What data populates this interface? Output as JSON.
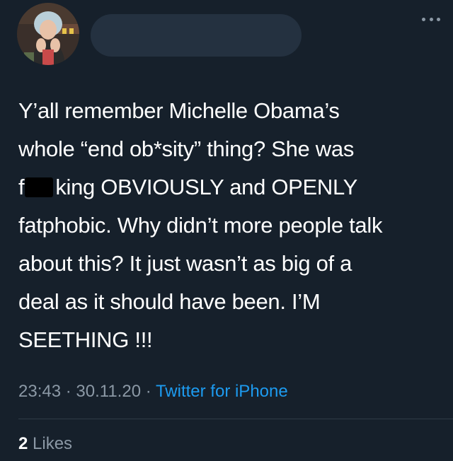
{
  "tweet": {
    "avatar_icon": "profile-photo",
    "text_lines": [
      "Y’all remember Michelle Obama’s",
      "whole “end ob*sity” thing? She was",
      [
        "f",
        "king OBVIOUSLY and OPENLY"
      ],
      "fatphobic. Why didn’t more people talk",
      "about this? It just wasn’t as big of a",
      "deal as it should have been. I’M",
      "SEETHING !!!"
    ],
    "time": "23:43",
    "date": "30.11.20",
    "separator": "·",
    "source": "Twitter for iPhone",
    "likes_count": "2",
    "likes_label": "Likes"
  },
  "colors": {
    "background": "#16202b",
    "text": "#ffffff",
    "muted": "#8b98a5",
    "link": "#1d9bf0"
  }
}
